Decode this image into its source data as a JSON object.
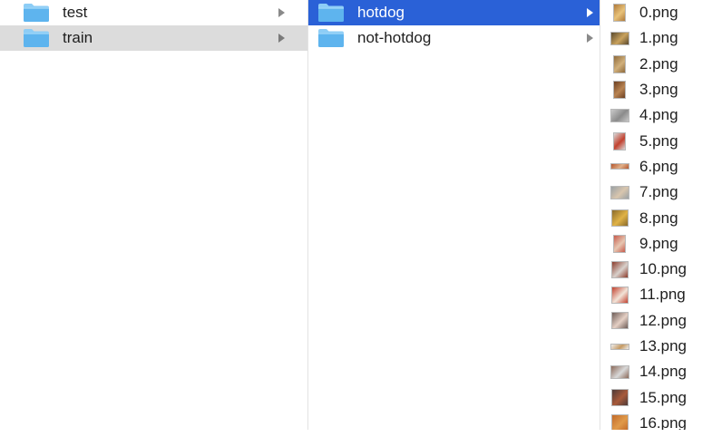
{
  "columns": [
    {
      "items": [
        {
          "label": "test",
          "type": "folder",
          "state": "normal"
        },
        {
          "label": "train",
          "type": "folder",
          "state": "selected-inactive"
        }
      ]
    },
    {
      "items": [
        {
          "label": "hotdog",
          "type": "folder",
          "state": "selected-active"
        },
        {
          "label": "not-hotdog",
          "type": "folder",
          "state": "normal"
        }
      ]
    },
    {
      "items": [
        {
          "label": "0.png",
          "thumb": "portrait",
          "colors": [
            "#b07a3a",
            "#e8c27a"
          ]
        },
        {
          "label": "1.png",
          "thumb": "landscape",
          "colors": [
            "#5a4a2e",
            "#c9a25d"
          ]
        },
        {
          "label": "2.png",
          "thumb": "portrait",
          "colors": [
            "#8f6a3b",
            "#d1b07c"
          ]
        },
        {
          "label": "3.png",
          "thumb": "portrait",
          "colors": [
            "#6b3f22",
            "#b98452"
          ]
        },
        {
          "label": "4.png",
          "thumb": "landscape",
          "colors": [
            "#c9c9c9",
            "#8b8b8b"
          ]
        },
        {
          "label": "5.png",
          "thumb": "portrait",
          "colors": [
            "#d9d9d9",
            "#c2412f"
          ]
        },
        {
          "label": "6.png",
          "thumb": "wide",
          "colors": [
            "#b5582f",
            "#e0b08a"
          ]
        },
        {
          "label": "7.png",
          "thumb": "landscape",
          "colors": [
            "#9aa1a5",
            "#d9c6ae"
          ]
        },
        {
          "label": "8.png",
          "thumb": "square",
          "colors": [
            "#8a6a2c",
            "#e0b347"
          ]
        },
        {
          "label": "9.png",
          "thumb": "portrait",
          "colors": [
            "#c75b4c",
            "#e7c7b2"
          ]
        },
        {
          "label": "10.png",
          "thumb": "square",
          "colors": [
            "#8c3c2c",
            "#d8d1cc"
          ]
        },
        {
          "label": "11.png",
          "thumb": "square",
          "colors": [
            "#c2412f",
            "#f2e4d8"
          ]
        },
        {
          "label": "12.png",
          "thumb": "square",
          "colors": [
            "#6e5d58",
            "#e5d0c5"
          ]
        },
        {
          "label": "13.png",
          "thumb": "wide",
          "colors": [
            "#eeeeee",
            "#c59a63"
          ]
        },
        {
          "label": "14.png",
          "thumb": "landscape",
          "colors": [
            "#8b6a5a",
            "#d9d9d9"
          ]
        },
        {
          "label": "15.png",
          "thumb": "square",
          "colors": [
            "#4d3a38",
            "#a85a3a"
          ]
        },
        {
          "label": "16.png",
          "thumb": "square",
          "colors": [
            "#c26a2a",
            "#e09a4a"
          ]
        }
      ]
    }
  ],
  "colors": {
    "selection_active": "#2a61d7",
    "selection_inactive": "#dcdcdc",
    "folder_body": "#5eb4ee",
    "folder_tab": "#8dcdf6"
  }
}
